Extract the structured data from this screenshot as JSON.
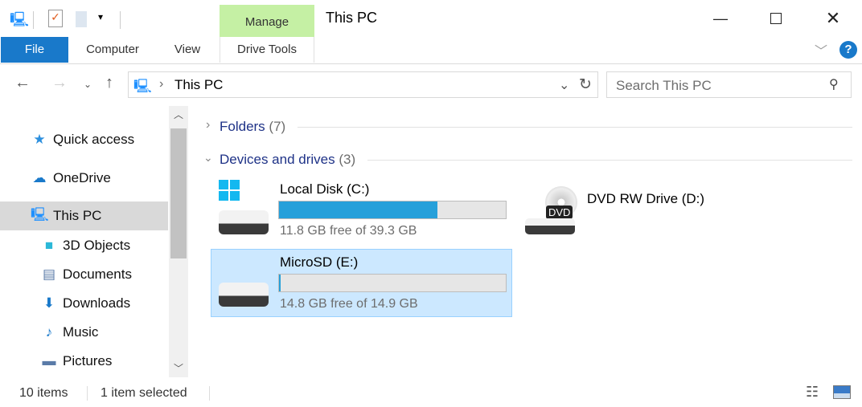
{
  "window": {
    "title": "This PC",
    "minimize_icon": "minimize-icon",
    "maximize_icon": "maximize-icon",
    "close_icon": "close-icon"
  },
  "ribbon": {
    "context_label": "Manage",
    "tabs": [
      {
        "label": "File"
      },
      {
        "label": "Computer"
      },
      {
        "label": "View"
      },
      {
        "label": "Drive Tools"
      }
    ],
    "colors": {
      "file": "#1979ca",
      "manage": "#c5f0a4"
    }
  },
  "address": {
    "path": "This PC",
    "search_placeholder": "Search This PC"
  },
  "sidebar": {
    "items": [
      {
        "label": "Quick access",
        "icon": "star-icon"
      },
      {
        "label": "OneDrive",
        "icon": "cloud-icon"
      },
      {
        "label": "This PC",
        "icon": "computer-icon",
        "selected": true
      },
      {
        "label": "3D Objects",
        "icon": "cube-icon"
      },
      {
        "label": "Documents",
        "icon": "document-icon"
      },
      {
        "label": "Downloads",
        "icon": "download-icon"
      },
      {
        "label": "Music",
        "icon": "music-icon"
      },
      {
        "label": "Pictures",
        "icon": "pictures-icon"
      }
    ]
  },
  "main": {
    "groups": [
      {
        "label": "Folders",
        "count": "(7)",
        "expanded": false
      },
      {
        "label": "Devices and drives",
        "count": "(3)",
        "expanded": true
      }
    ],
    "drives": [
      {
        "name": "Local Disk (C:)",
        "free": "11.8 GB free of 39.3 GB",
        "used_percent": 70,
        "icon": "windows-drive-icon"
      },
      {
        "name": "DVD RW Drive (D:)",
        "icon": "dvd-drive-icon",
        "dvd_label": "DVD"
      },
      {
        "name": "MicroSD (E:)",
        "free": "14.8 GB free of 14.9 GB",
        "used_percent": 0.7,
        "selected": true,
        "icon": "drive-icon"
      }
    ]
  },
  "status": {
    "items": "10 items",
    "selected": "1 item selected"
  }
}
